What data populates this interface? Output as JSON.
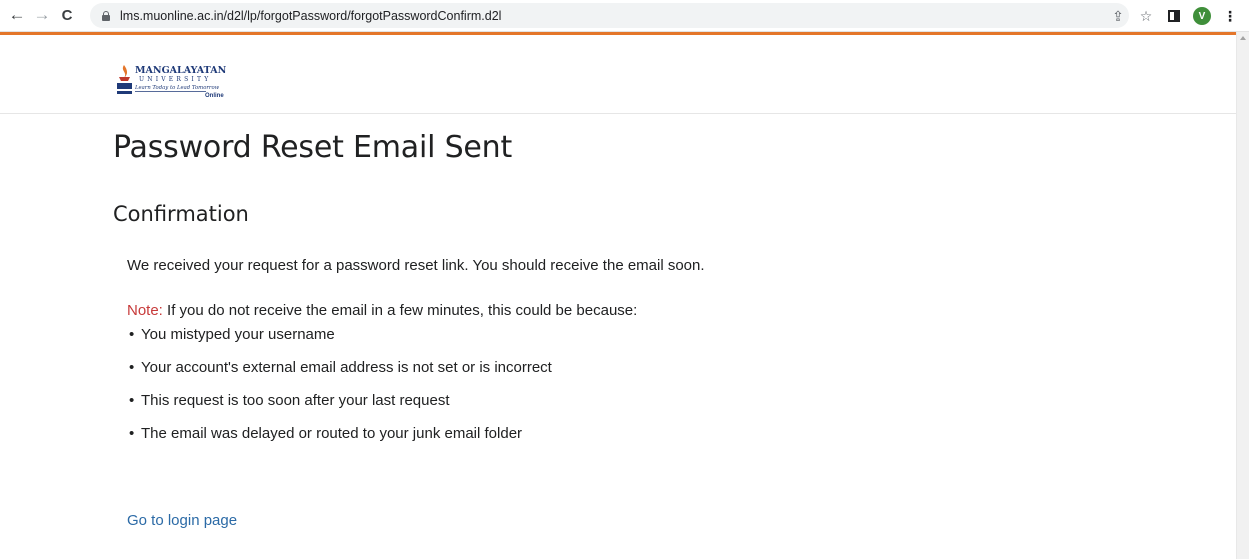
{
  "browser": {
    "url": "lms.muonline.ac.in/d2l/lp/forgotPassword/forgotPasswordConfirm.d2l",
    "profile_initial": "V",
    "back_icon": "←",
    "forward_icon": "→",
    "reload_icon": "C",
    "share_icon": "⇪",
    "star_icon": "☆",
    "menu_icon": "⋮"
  },
  "logo": {
    "name": "MANGALAYATAN",
    "subname": "UNIVERSITY",
    "tagline": "Learn Today to Lead Tomorrow",
    "online": "Online"
  },
  "page": {
    "title": "Password Reset Email Sent",
    "section_heading": "Confirmation",
    "message": "We received your request for a password reset link. You should receive the email soon.",
    "note_label": "Note:",
    "note_text": " If you do not receive the email in a few minutes, this could be because:",
    "reasons": [
      "You mistyped your username",
      "Your account's external email address is not set or is incorrect",
      "This request is too soon after your last request",
      "The email was delayed or routed to your junk email folder"
    ],
    "login_link": "Go to login page"
  },
  "colors": {
    "accent": "#e4762a",
    "note": "#c73a3a",
    "link": "#2b6aa6",
    "avatar": "#3f8f3a"
  }
}
